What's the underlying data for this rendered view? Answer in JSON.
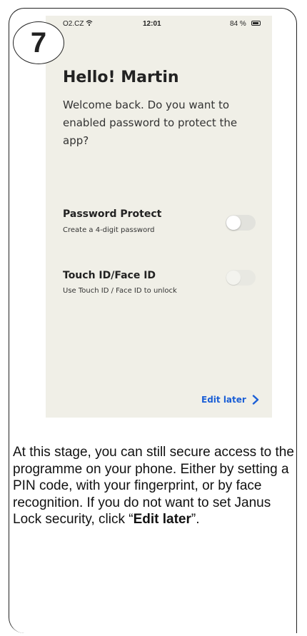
{
  "step_number": "7",
  "status_bar": {
    "carrier": "O2.CZ",
    "time": "12:01",
    "battery": "84 %",
    "battery_level": 0.84
  },
  "screen": {
    "greeting": "Hello! Martin",
    "message": "Welcome back. Do you want to enabled password to protect the app?",
    "options": [
      {
        "title": "Password Protect",
        "subtitle": "Create a 4-digit password",
        "enabled": false
      },
      {
        "title": "Touch ID/Face ID",
        "subtitle": "Use Touch ID / Face ID to unlock",
        "enabled": false
      }
    ],
    "edit_later": "Edit later"
  },
  "description": {
    "text_before": "At this stage, you can still secure access to the programme on your phone. Either by setting a PIN code, with your fingerprint, or by face recognition. If you do not want to set Janus Lock security, click “",
    "bold": "Edit later",
    "text_after": "”."
  },
  "colors": {
    "screen_bg": "#f0efe7",
    "link": "#1b5fd6",
    "toggle_off": "#e2e2dd"
  }
}
